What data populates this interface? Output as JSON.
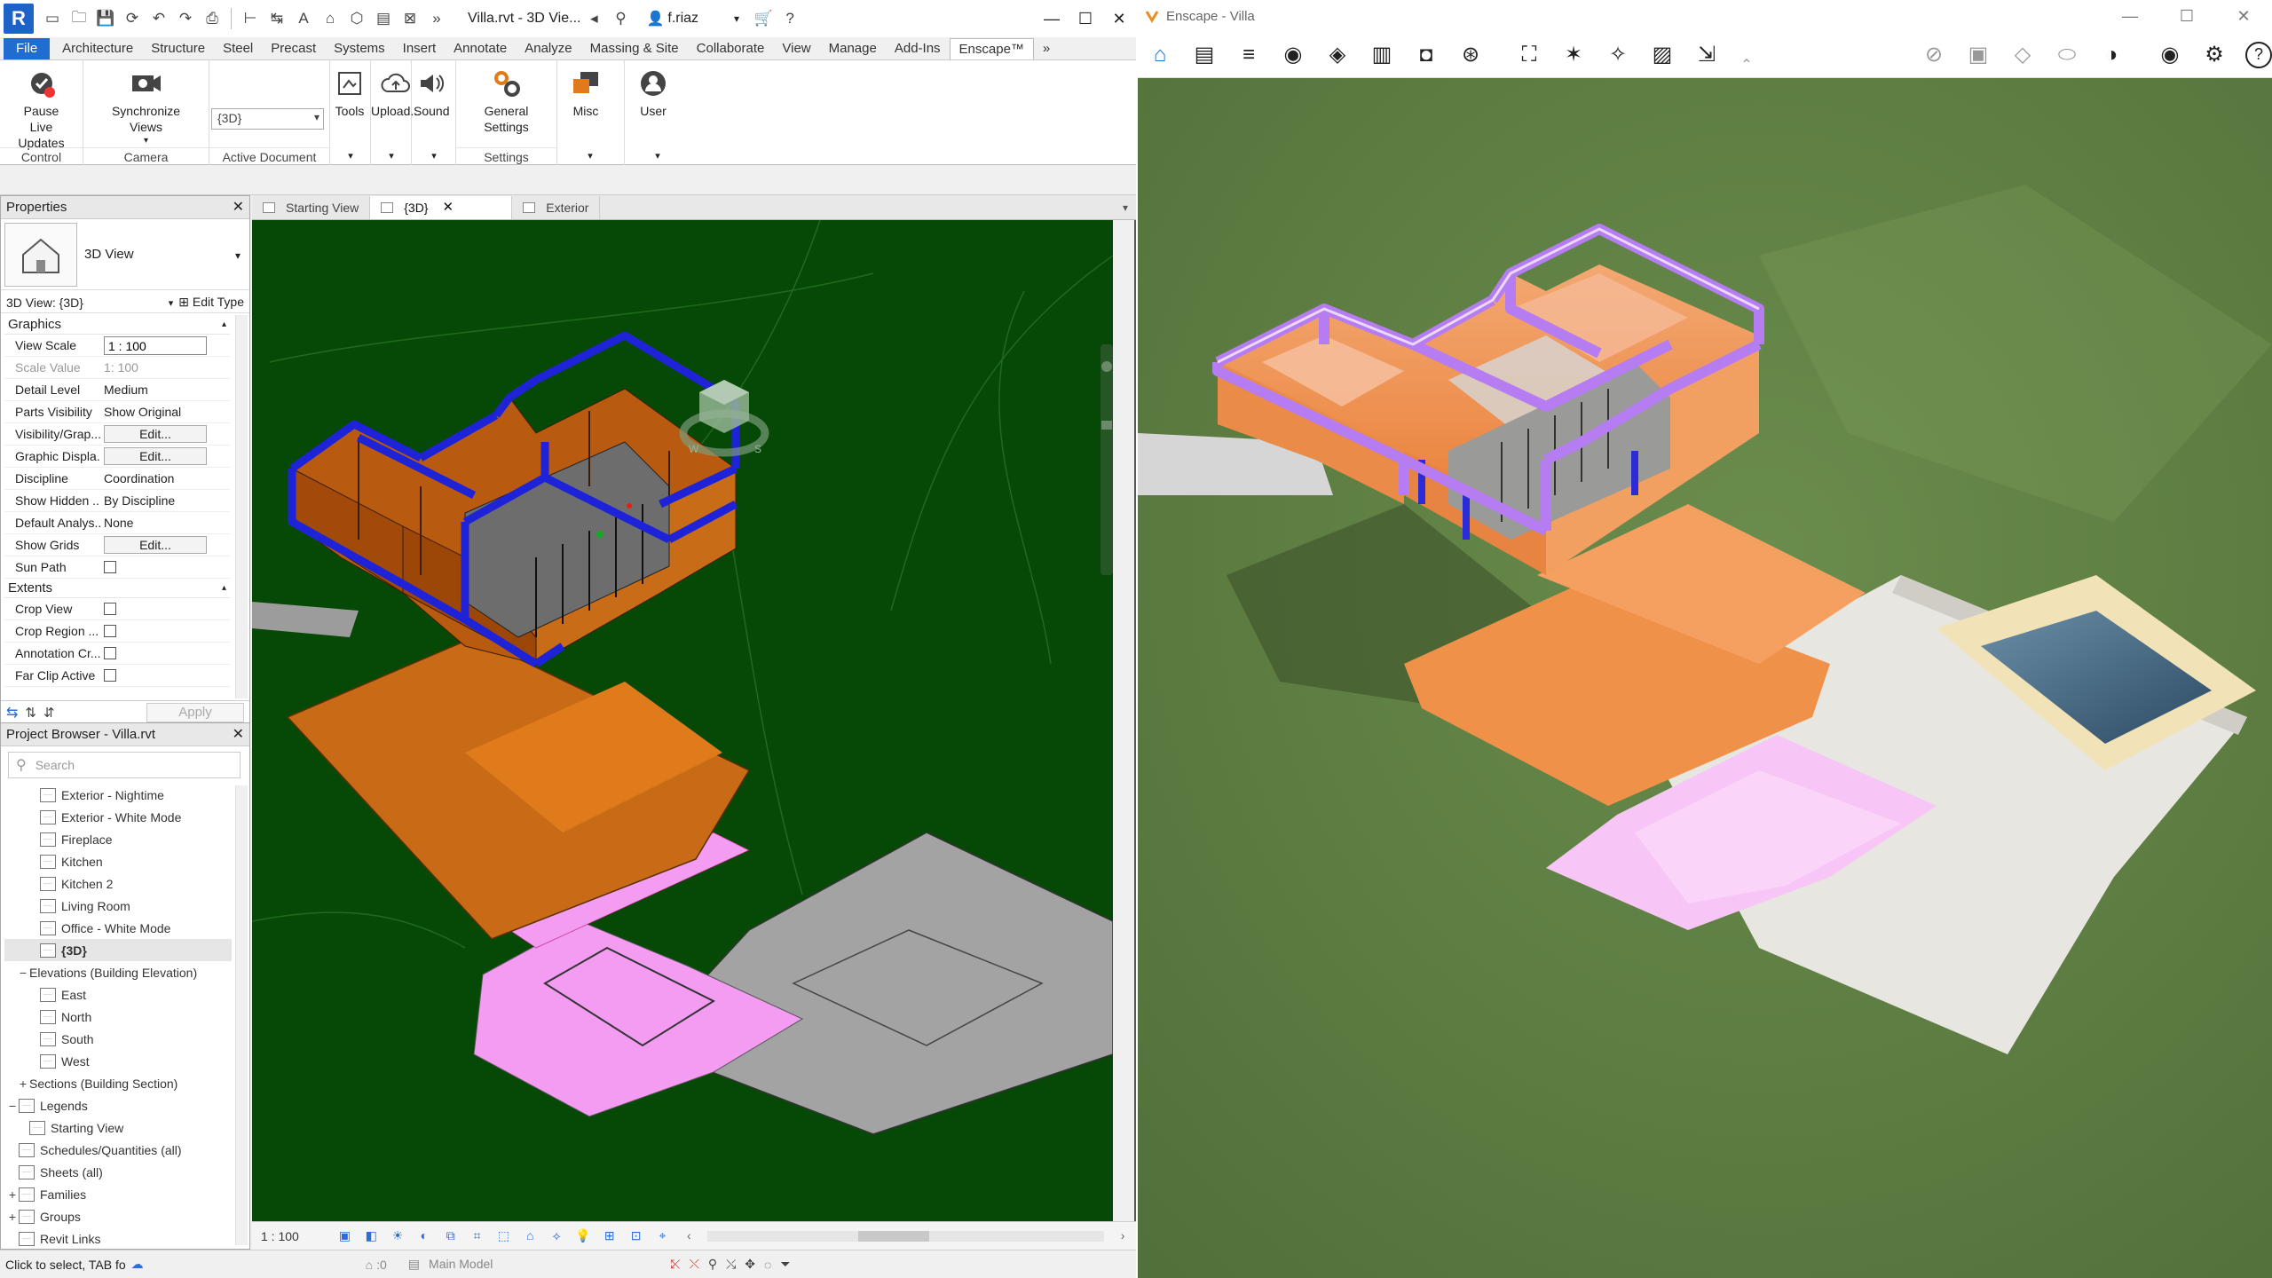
{
  "revit": {
    "title": "Villa.rvt - 3D Vie...",
    "user": "f.riaz",
    "tabs": [
      "File",
      "Architecture",
      "Structure",
      "Steel",
      "Precast",
      "Systems",
      "Insert",
      "Annotate",
      "Analyze",
      "Massing & Site",
      "Collaborate",
      "View",
      "Manage",
      "Add-Ins",
      "Enscape™"
    ],
    "active_tab": "Enscape™",
    "ribbon": {
      "pause_live_updates": "Pause Live Updates",
      "control_panel": "Control",
      "sync_views": "Synchronize Views",
      "camera_panel": "Camera",
      "active_doc_value": "{3D}",
      "active_doc_panel": "Active Document",
      "tools": "Tools",
      "upload": "Upload...",
      "sound": "Sound",
      "general_settings": "General Settings",
      "settings_panel": "Settings",
      "misc": "Misc",
      "user": "User"
    },
    "properties": {
      "header": "Properties",
      "type_name": "3D View",
      "instance": "3D View: {3D}",
      "edit_type": "Edit Type",
      "group_graphics": "Graphics",
      "rows": [
        {
          "k": "View Scale",
          "v": "1 : 100"
        },
        {
          "k": "Scale Value",
          "v": "1:  100"
        },
        {
          "k": "Detail Level",
          "v": "Medium"
        },
        {
          "k": "Parts Visibility",
          "v": "Show Original"
        },
        {
          "k": "Visibility/Grap...",
          "v": "Edit..."
        },
        {
          "k": "Graphic Displa...",
          "v": "Edit..."
        },
        {
          "k": "Discipline",
          "v": "Coordination"
        },
        {
          "k": "Show Hidden ...",
          "v": "By Discipline"
        },
        {
          "k": "Default Analys...",
          "v": "None"
        },
        {
          "k": "Show Grids",
          "v": "Edit..."
        },
        {
          "k": "Sun Path",
          "v": ""
        }
      ],
      "group_extents": "Extents",
      "extent_rows": [
        {
          "k": "Crop View"
        },
        {
          "k": "Crop Region ..."
        },
        {
          "k": "Annotation Cr..."
        },
        {
          "k": "Far Clip Active"
        }
      ],
      "apply": "Apply"
    },
    "browser": {
      "header": "Project Browser - Villa.rvt",
      "search_placeholder": "Search",
      "items": [
        {
          "label": "Exterior - Nightime",
          "level": 3,
          "type": "view"
        },
        {
          "label": "Exterior - White Mode",
          "level": 3,
          "type": "view"
        },
        {
          "label": "Fireplace",
          "level": 3,
          "type": "view"
        },
        {
          "label": "Kitchen",
          "level": 3,
          "type": "view"
        },
        {
          "label": "Kitchen 2",
          "level": 3,
          "type": "view"
        },
        {
          "label": "Living Room",
          "level": 3,
          "type": "view"
        },
        {
          "label": "Office - White Mode",
          "level": 3,
          "type": "view"
        },
        {
          "label": "{3D}",
          "level": 3,
          "type": "view",
          "selected": true
        },
        {
          "label": "Elevations (Building Elevation)",
          "level": 2,
          "type": "group",
          "tog": "−"
        },
        {
          "label": "East",
          "level": 3,
          "type": "view"
        },
        {
          "label": "North",
          "level": 3,
          "type": "view"
        },
        {
          "label": "South",
          "level": 3,
          "type": "view"
        },
        {
          "label": "West",
          "level": 3,
          "type": "view"
        },
        {
          "label": "Sections (Building Section)",
          "level": 2,
          "type": "group",
          "tog": "+"
        },
        {
          "label": "Legends",
          "level": 1,
          "type": "folder",
          "tog": "−"
        },
        {
          "label": "Starting View",
          "level": 2,
          "type": "view"
        },
        {
          "label": "Schedules/Quantities (all)",
          "level": 1,
          "type": "folder",
          "tog": ""
        },
        {
          "label": "Sheets (all)",
          "level": 1,
          "type": "folder",
          "tog": ""
        },
        {
          "label": "Families",
          "level": 1,
          "type": "folder",
          "tog": "+"
        },
        {
          "label": "Groups",
          "level": 1,
          "type": "folder",
          "tog": "+"
        },
        {
          "label": "Revit Links",
          "level": 1,
          "type": "folder",
          "tog": ""
        }
      ]
    },
    "view_tabs": [
      {
        "label": "Starting View",
        "active": false
      },
      {
        "label": "{3D}",
        "active": true
      },
      {
        "label": "Exterior",
        "active": false
      }
    ],
    "view_scale": "1 : 100",
    "status_text": "Click to select, TAB fo",
    "status_model": "Main Model",
    "status_zero": ":0"
  },
  "enscape": {
    "title": "Enscape - Villa",
    "toolbar_icons": [
      "home-icon",
      "views-icon",
      "bim-icon",
      "visual-settings-icon",
      "video-editor-icon",
      "asset-library-icon",
      "materials-icon",
      "render-icon",
      "screenshot-icon",
      "batch-icon",
      "magic-icon",
      "image-icon",
      "export-icon",
      "collapse-icon",
      "hide-icon",
      "image-2-icon",
      "cube-icon",
      "vr-icon",
      "headset-icon",
      "eye-icon",
      "settings-icon",
      "help-icon"
    ]
  },
  "colors": {
    "revit_bg_view": "#064906",
    "enscape_ground": "#5e7f43",
    "walls": "#c45d0a",
    "wall_tops": "#1f23d8",
    "deck": "#ea8f2a",
    "paving_pink": "#f39cf2",
    "enscape_roof": "#b67cf2"
  }
}
